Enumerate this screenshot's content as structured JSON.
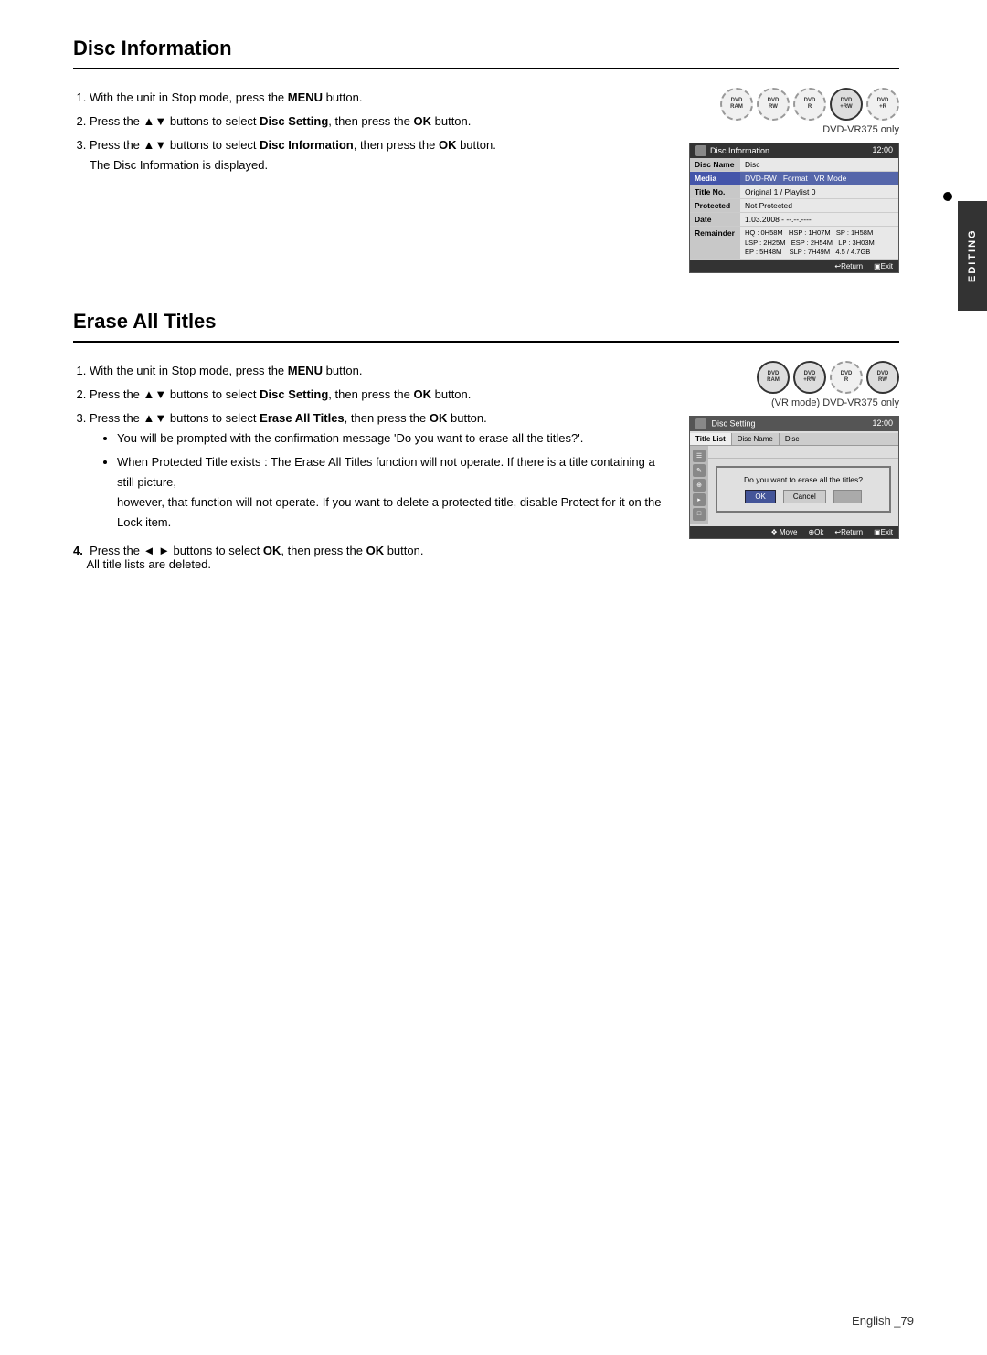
{
  "page": {
    "footer": "English _79",
    "side_tab": "EDITING"
  },
  "disc_information": {
    "title": "Disc Information",
    "dvd_label": "DVD-VR375 only",
    "disc_icons": [
      {
        "label": "DVD-RAM",
        "active": false
      },
      {
        "label": "DVD-RW",
        "active": false
      },
      {
        "label": "DVD-R",
        "active": false
      },
      {
        "label": "DVD+RW",
        "active": false
      },
      {
        "label": "DVD+R",
        "active": false
      }
    ],
    "steps": [
      {
        "num": "1",
        "text": "With the unit in Stop mode, press the ",
        "bold": "MENU",
        "after": " button."
      },
      {
        "num": "2",
        "text": "Press the ▲▼ buttons to select ",
        "bold": "Disc Setting",
        "after": ", then press the ",
        "bold2": "OK",
        "after2": " button."
      },
      {
        "num": "3",
        "text": "Press the ▲▼ buttons to select ",
        "bold": "Disc Information",
        "after": ", then press the ",
        "bold2": "OK",
        "after2": " button."
      }
    ],
    "note": "The Disc Information is displayed.",
    "screen": {
      "header_title": "Disc Information",
      "header_time": "12:00",
      "rows": [
        {
          "label": "Disc Name",
          "value": "Disc",
          "highlight": false
        },
        {
          "label": "Media",
          "value": "DVD-RW    Format    VR Mode",
          "highlight": true
        },
        {
          "label": "Title No.",
          "value": "Original 1 / Playlist 0",
          "highlight": false
        },
        {
          "label": "Protected",
          "value": "Not Protected",
          "highlight": false
        },
        {
          "label": "Date",
          "value": "1.03.2008 - --:--:----",
          "highlight": false
        },
        {
          "label": "Remainder",
          "value": "HQ : 0H58M  HSP : 1H07M  SP : 1H58M\nLSP : 2H25M  ESP : 2H54M  LP : 3H03M\nEP : 5H48M   SLP : 7H49M  4.5 / 4.7GB",
          "highlight": false
        }
      ],
      "footer_return": "↩Return",
      "footer_exit": "▣Exit"
    }
  },
  "erase_all_titles": {
    "title": "Erase All Titles",
    "dvd_label": "(VR mode)  DVD-VR375 only",
    "disc_icons": [
      {
        "label": "DVD-RAM",
        "active": false
      },
      {
        "label": "DVD+RW",
        "active": false
      },
      {
        "label": "DVD-R",
        "active": false
      },
      {
        "label": "DVD-RW",
        "active": false
      }
    ],
    "steps": [
      {
        "num": "1",
        "text": "With the unit in Stop mode, press the ",
        "bold": "MENU",
        "after": " button."
      },
      {
        "num": "2",
        "text": "Press the ▲▼ buttons to select ",
        "bold": "Disc Setting",
        "after": ", then press the ",
        "bold2": "OK",
        "after2": " button."
      },
      {
        "num": "3",
        "text": "Press the ▲▼ buttons to select ",
        "bold": "Erase All Titles",
        "after": ", then press the ",
        "bold2": "OK",
        "after2": " button."
      }
    ],
    "bullets": [
      "You will be prompted with the confirmation message 'Do you want to erase all the titles?'.",
      "When Protected Title exists : The Erase All Titles function will not operate. If there is a title containing a still picture, however, that function will not operate. If you want to delete a protected title, disable Protect for it on the Lock item."
    ],
    "step4": {
      "text": "Press the ◄ ► buttons to select ",
      "bold": "OK",
      "after": ", then press the ",
      "bold2": "OK",
      "after2": " button."
    },
    "step4_note": "All title lists are deleted.",
    "screen": {
      "header_title": "Disc Setting",
      "header_time": "12:00",
      "tabs": [
        {
          "label": "Title List",
          "active": false
        },
        {
          "label": "Disc Name",
          "active": false
        },
        {
          "label": "Disc",
          "active": false
        }
      ],
      "dialog_text": "Do you want to erase all the titles?",
      "buttons": [
        {
          "label": "OK",
          "selected": true
        },
        {
          "label": "Cancel",
          "selected": false
        }
      ],
      "footer_move": "❖ Move",
      "footer_ok": "⊕Ok",
      "footer_return": "↩Return",
      "footer_exit": "▣Exit"
    }
  }
}
